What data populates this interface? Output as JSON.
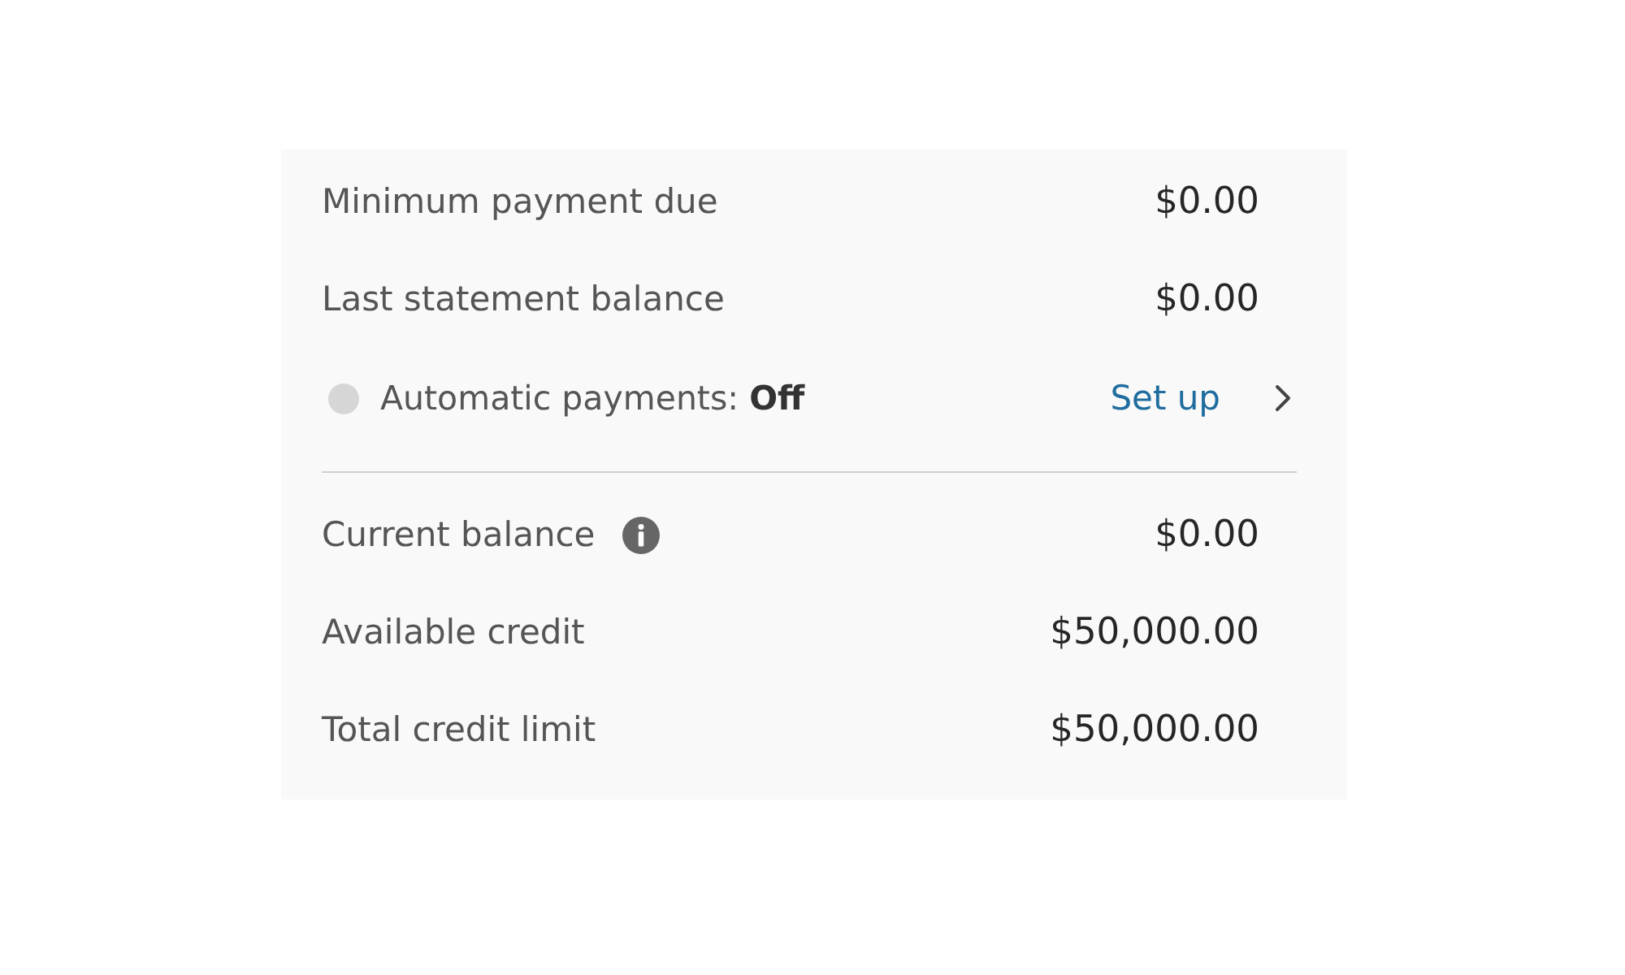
{
  "summary_rows": [
    {
      "label": "Minimum payment due",
      "value": "$0.00"
    },
    {
      "label": "Last statement balance",
      "value": "$0.00"
    }
  ],
  "autopay": {
    "label": "Automatic payments: **Off**",
    "on": false,
    "action": "Set up"
  },
  "balance_rows": [
    {
      "label": "Current balance",
      "value": "$0.00",
      "info": true
    },
    {
      "label": "Available credit",
      "value": "$50,000.00",
      "info": false
    },
    {
      "label": "Total credit limit",
      "value": "$50,000.00",
      "info": false
    }
  ]
}
